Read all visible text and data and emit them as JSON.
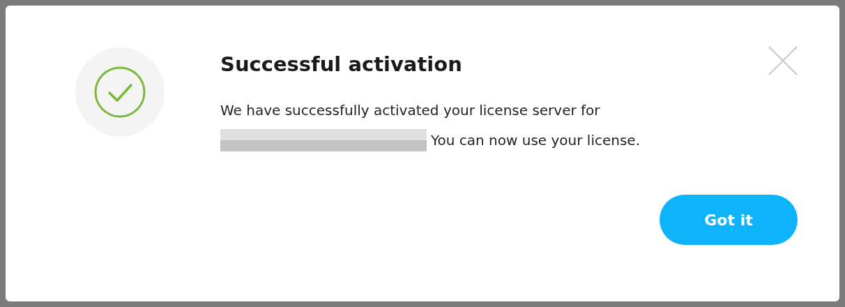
{
  "dialog": {
    "title": "Successful activation",
    "message_line_1": "We have successfully activated your license server for",
    "message_line_2": "You can now use your license.",
    "button": "Got it"
  }
}
